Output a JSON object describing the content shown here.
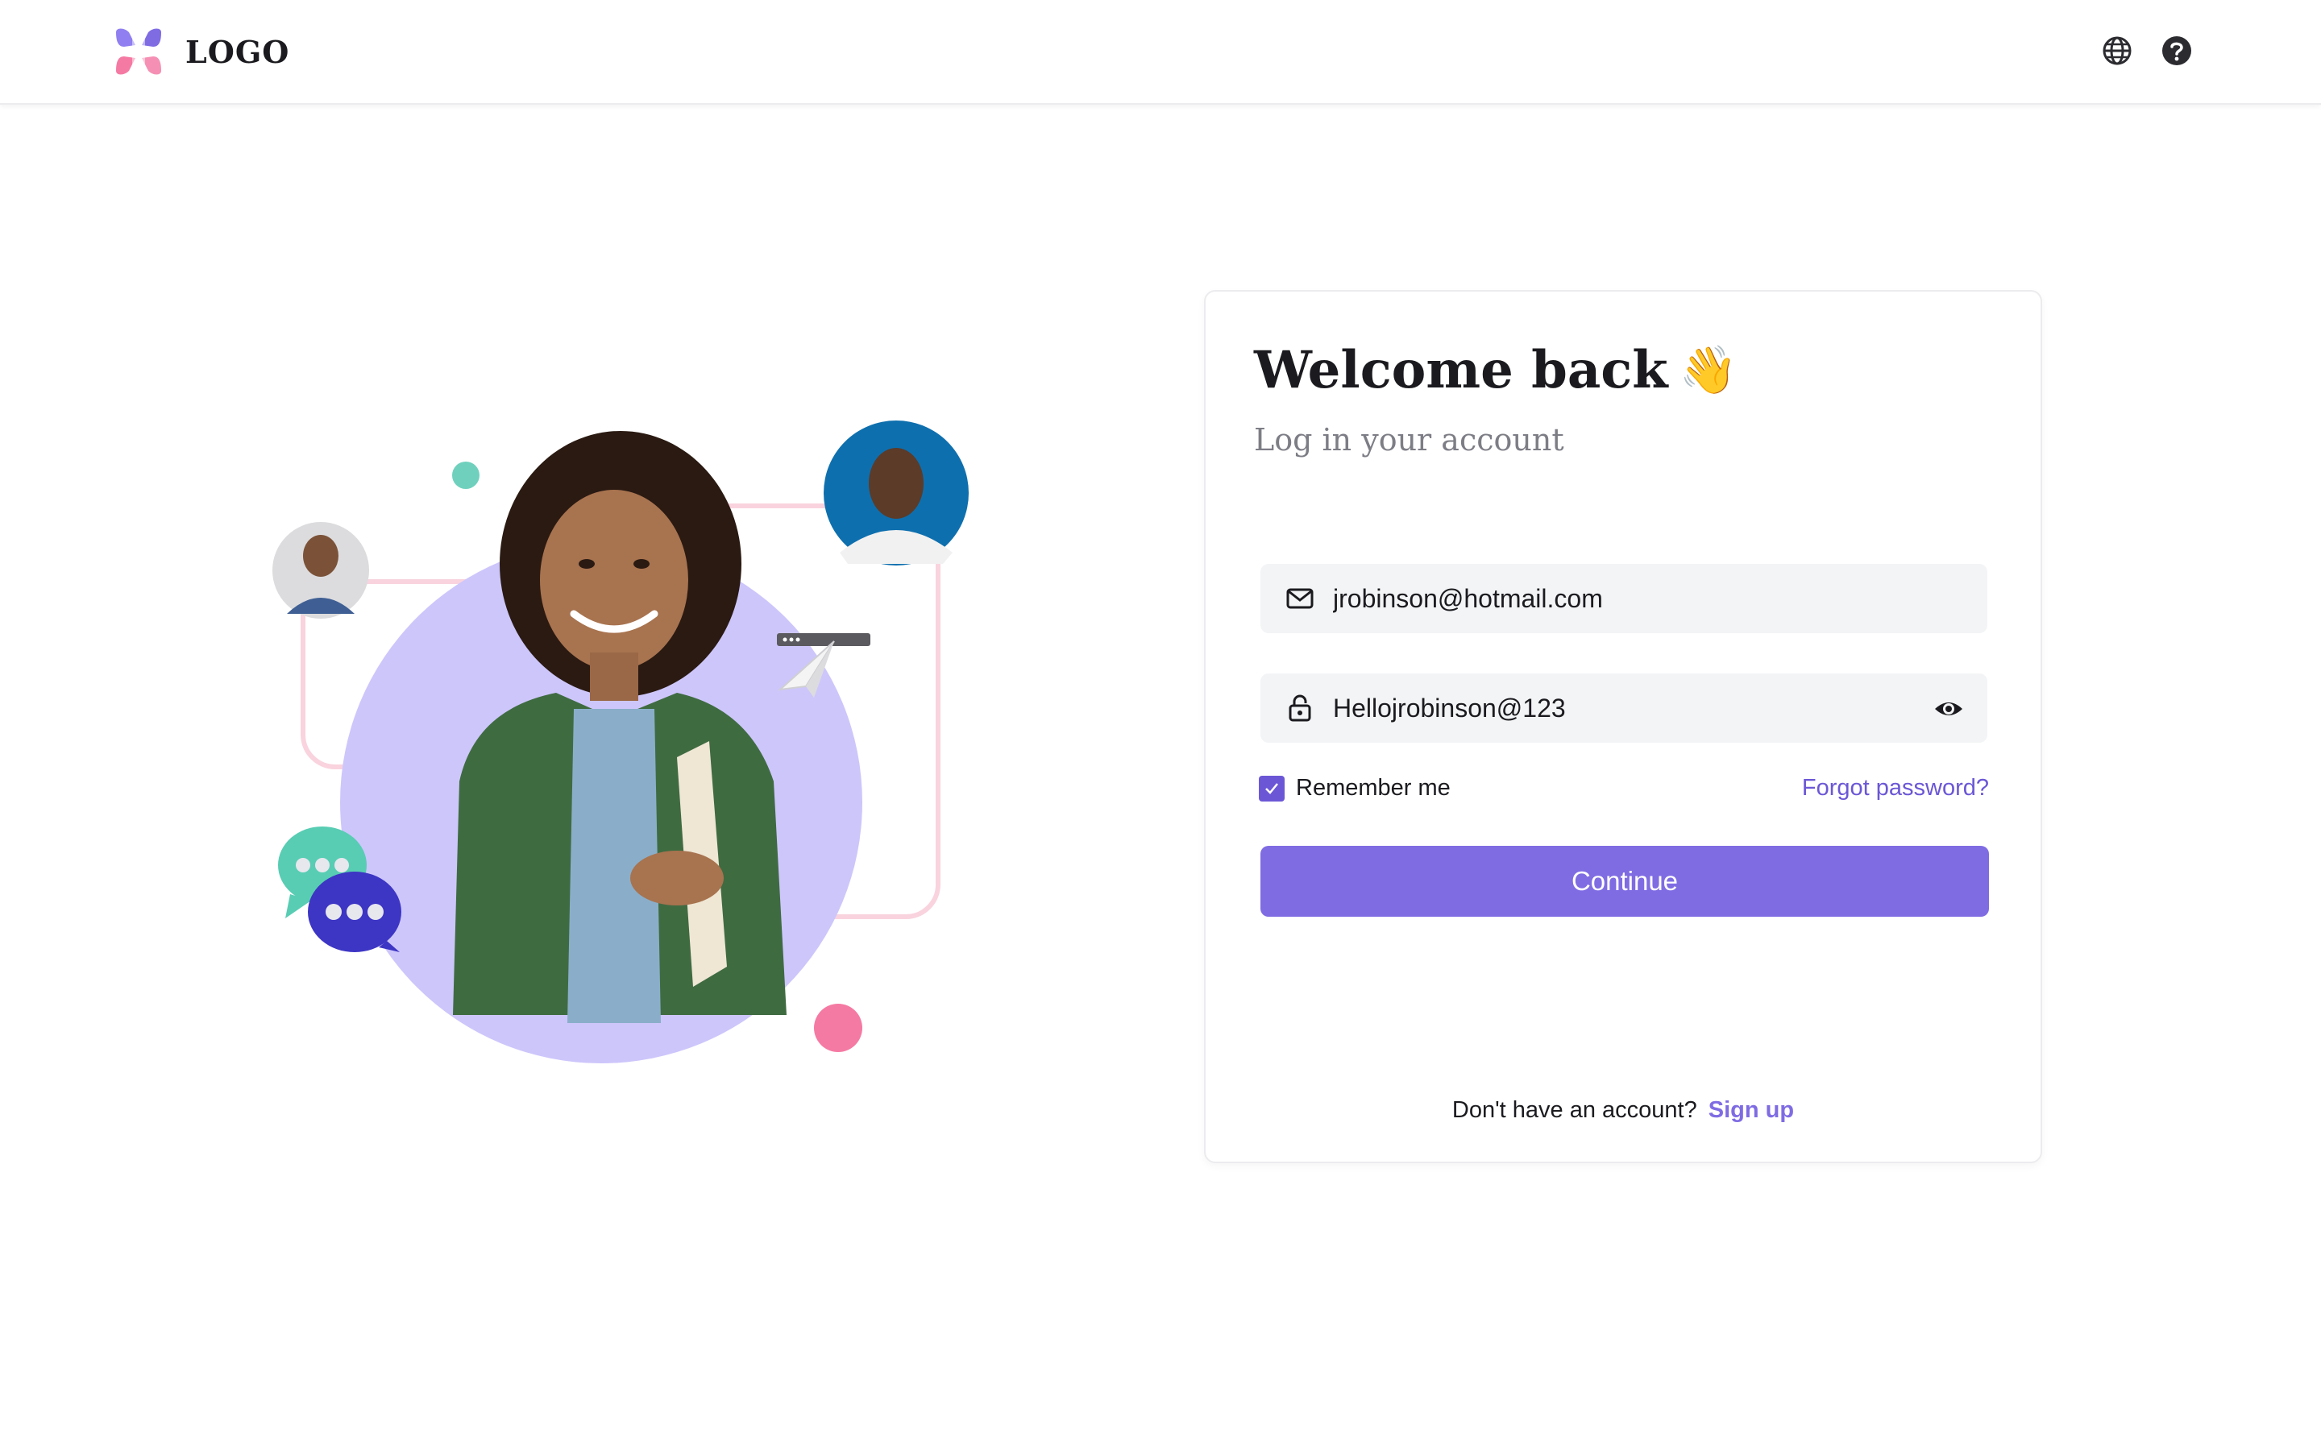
{
  "header": {
    "logo_text": "LOGO",
    "icons": [
      "globe-icon",
      "help-icon"
    ]
  },
  "login": {
    "title": "Welcome back",
    "title_emoji": "👋",
    "subtitle": "Log in your account",
    "email_value": "jrobinson@hotmail.com",
    "password_value": "Hellojrobinson@123",
    "remember_label": "Remember me",
    "remember_checked": true,
    "forgot_label": "Forgot password?",
    "continue_label": "Continue",
    "no_account_text": "Don't have an account?",
    "signup_label": "Sign up"
  },
  "colors": {
    "accent": "#7f6ce3",
    "link": "#6b57d6",
    "field_bg": "#f3f4f6",
    "illustration_circle": "#cdc6fb",
    "frame_pink": "#f9d3de",
    "dot_teal": "#6fd1bd",
    "dot_pink": "#f57aa3"
  }
}
